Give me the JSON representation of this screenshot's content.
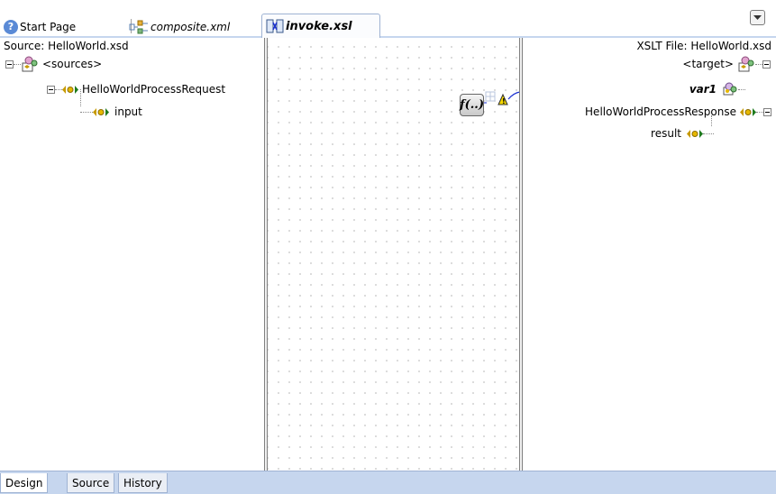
{
  "tabs": [
    {
      "label": "Start Page",
      "icon": "help-icon"
    },
    {
      "label": "composite.xml",
      "icon": "composite-icon"
    },
    {
      "label": "invoke.xsl",
      "icon": "xsl-map-icon",
      "active": true
    }
  ],
  "source": {
    "header": "Source: HelloWorld.xsd",
    "root": "<sources>",
    "request": "HelloWorldProcessRequest",
    "input": "input"
  },
  "target": {
    "header": "XSLT File: HelloWorld.xsd",
    "root": "<target>",
    "var": "var1",
    "response": "HelloWorldProcessResponse",
    "result": "result"
  },
  "function": {
    "label": "f(..)"
  },
  "bottom_tabs": [
    "Design",
    "Source",
    "History"
  ],
  "colors": {
    "link_line": "#1a2fd0",
    "tab_strip": "#c6d6ee",
    "element_icon_left": "#c79a00",
    "element_icon_right": "#1e7a1e",
    "warning": "#f5d800"
  }
}
